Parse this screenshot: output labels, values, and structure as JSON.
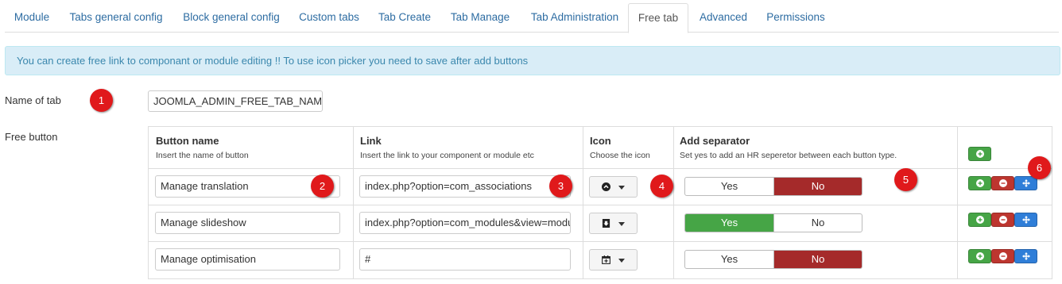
{
  "tabs": [
    {
      "label": "Module"
    },
    {
      "label": "Tabs general config"
    },
    {
      "label": "Block general config"
    },
    {
      "label": "Custom tabs"
    },
    {
      "label": "Tab Create"
    },
    {
      "label": "Tab Manage"
    },
    {
      "label": "Tab Administration"
    },
    {
      "label": "Free tab",
      "active": true
    },
    {
      "label": "Advanced"
    },
    {
      "label": "Permissions"
    }
  ],
  "alert": "You can create free link to componant or module editing !! To use icon picker you need to save after add buttons",
  "form": {
    "name_label": "Name of tab",
    "name_value": "JOOMLA_ADMIN_FREE_TAB_NAME",
    "free_button_label": "Free button"
  },
  "table": {
    "headers": [
      {
        "title": "Button name",
        "sub": "Insert the name of button"
      },
      {
        "title": "Link",
        "sub": "Insert the link to your component or module etc"
      },
      {
        "title": "Icon",
        "sub": "Choose the icon"
      },
      {
        "title": "Add separator",
        "sub": "Set yes to add an HR seperetor between each button type."
      }
    ],
    "toggle_labels": {
      "yes": "Yes",
      "no": "No"
    },
    "rows": [
      {
        "name": "Manage translation",
        "link": "index.php?option=com_associations",
        "icon": "chevron-circle-up-icon",
        "separator": "No"
      },
      {
        "name": "Manage slideshow",
        "link": "index.php?option=com_modules&view=modules",
        "icon": "download-icon",
        "separator": "Yes"
      },
      {
        "name": "Manage optimisation",
        "link": "#",
        "icon": "calendar-plus-icon",
        "separator": "No"
      }
    ]
  },
  "badges": [
    "1",
    "2",
    "3",
    "4",
    "5",
    "6"
  ],
  "colors": {
    "accent": "#2d6ca2",
    "info_bg": "#d9edf7",
    "info_text": "#3a87ad",
    "toggle_yes": "#46a546",
    "toggle_no": "#a52a2a",
    "badge": "#e0191b"
  }
}
